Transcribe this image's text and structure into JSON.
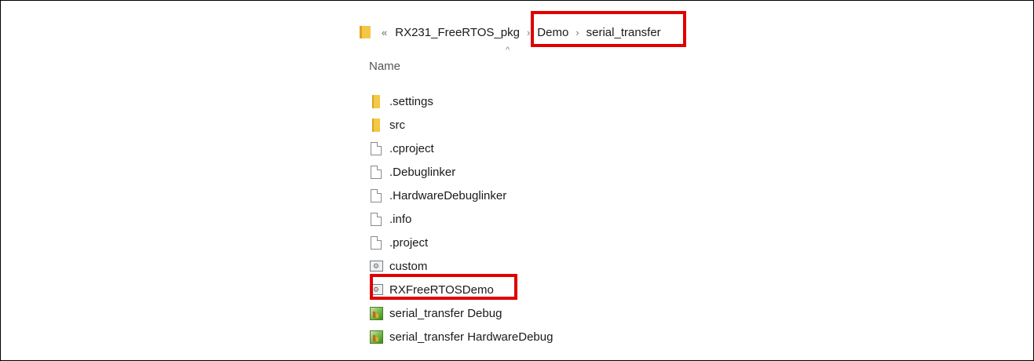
{
  "breadcrumb": {
    "overflow_glyph": "«",
    "items": [
      "RX231_FreeRTOS_pkg",
      "Demo",
      "serial_transfer"
    ],
    "separator": "›"
  },
  "columns": {
    "name": "Name",
    "sort_indicator": "^"
  },
  "files": [
    {
      "name": ".settings",
      "icon": "folder-icon"
    },
    {
      "name": "src",
      "icon": "folder-icon"
    },
    {
      "name": ".cproject",
      "icon": "document-icon"
    },
    {
      "name": ".Debuglinker",
      "icon": "document-icon"
    },
    {
      "name": ".HardwareDebuglinker",
      "icon": "document-icon"
    },
    {
      "name": ".info",
      "icon": "document-icon"
    },
    {
      "name": ".project",
      "icon": "document-icon"
    },
    {
      "name": "custom",
      "icon": "config-file-icon"
    },
    {
      "name": "RXFreeRTOSDemo",
      "icon": "config-file-icon"
    },
    {
      "name": "serial_transfer Debug",
      "icon": "launch-config-icon"
    },
    {
      "name": "serial_transfer HardwareDebug",
      "icon": "launch-config-icon"
    }
  ],
  "colors": {
    "highlight": "#e00000",
    "folder": "#f3c846"
  }
}
